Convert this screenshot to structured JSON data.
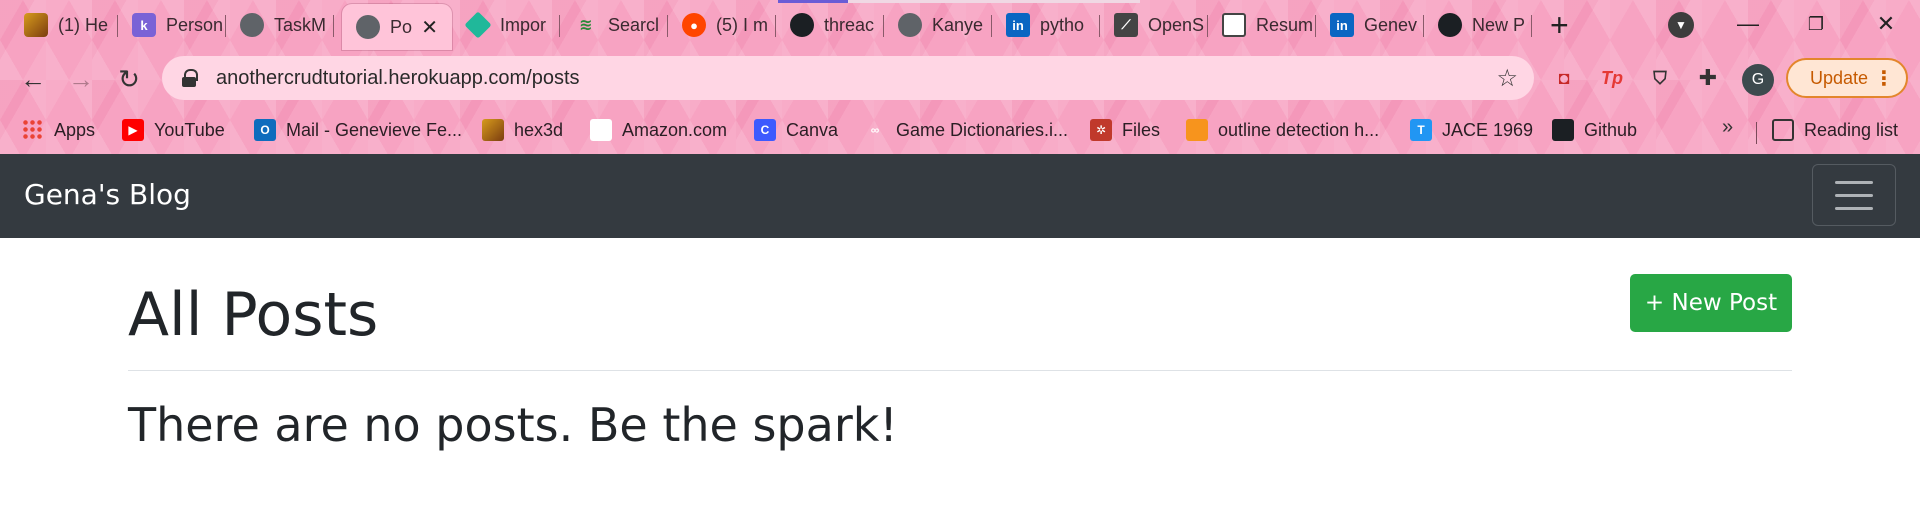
{
  "browser": {
    "tabs": [
      {
        "label": "(1) He",
        "icon": "hex-icon"
      },
      {
        "label": "Person",
        "icon": "k-icon"
      },
      {
        "label": "TaskM",
        "icon": "globe-icon"
      },
      {
        "label": "Po",
        "icon": "globe-icon",
        "active": true
      },
      {
        "label": "Impor",
        "icon": "diamond-icon"
      },
      {
        "label": "Searcl",
        "icon": "search-icon"
      },
      {
        "label": "(5) I m",
        "icon": "reddit-icon"
      },
      {
        "label": "threac",
        "icon": "github-icon"
      },
      {
        "label": "Kanye",
        "icon": "globe-icon"
      },
      {
        "label": "pytho",
        "icon": "linkedin-icon"
      },
      {
        "label": "OpenS",
        "icon": "document-icon"
      },
      {
        "label": "Resum",
        "icon": "resume-icon"
      },
      {
        "label": "Genev",
        "icon": "linkedin-icon"
      },
      {
        "label": "New P",
        "icon": "github-icon"
      }
    ],
    "url": "anothercrudtutorial.herokuapp.com/posts",
    "avatar_letter": "G",
    "update_label": "Update",
    "bookmarks": [
      {
        "label": "Apps",
        "icon": "apps-grid-icon"
      },
      {
        "label": "YouTube",
        "icon": "youtube-icon"
      },
      {
        "label": "Mail - Genevieve Fe...",
        "icon": "outlook-icon"
      },
      {
        "label": "hex3d",
        "icon": "hex-icon"
      },
      {
        "label": "Amazon.com",
        "icon": "amazon-icon"
      },
      {
        "label": "Canva",
        "icon": "canva-icon"
      },
      {
        "label": "Game Dictionaries.i...",
        "icon": "game-icon"
      },
      {
        "label": "Files",
        "icon": "files-icon"
      },
      {
        "label": "outline detection h...",
        "icon": "book-icon"
      },
      {
        "label": "JACE 1969",
        "icon": "jace-icon"
      },
      {
        "label": "Github",
        "icon": "github-icon"
      }
    ],
    "reading_list": "Reading list"
  },
  "site": {
    "brand": "Gena's Blog",
    "page_title": "All Posts",
    "new_post_button": "+ New Post",
    "empty_message": "There are no posts. Be the spark!"
  },
  "colors": {
    "navbar_bg": "#343a40",
    "success_green": "#28a745",
    "chrome_pink": "#f7a3c2"
  }
}
